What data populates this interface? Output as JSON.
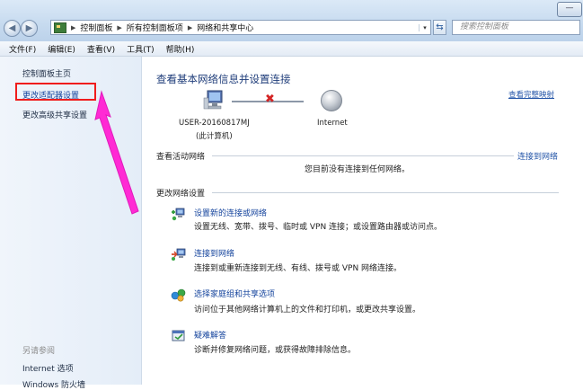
{
  "window": {
    "buttons": [
      "—"
    ]
  },
  "nav": {
    "back_glyph": "◀",
    "forward_glyph": "▶"
  },
  "address": {
    "crumbs": [
      "控制面板",
      "所有控制面板项",
      "网络和共享中心"
    ],
    "dropdown_glyph": "▾"
  },
  "refresh_glyph": "⇆",
  "search": {
    "placeholder": "搜索控制面板"
  },
  "menu": [
    "文件(F)",
    "编辑(E)",
    "查看(V)",
    "工具(T)",
    "帮助(H)"
  ],
  "sidebar": {
    "items": [
      "控制面板主页",
      "更改适配器设置",
      "更改高级共享设置"
    ],
    "see_also_title": "另请参阅",
    "see_also": [
      "Internet 选项",
      "Windows 防火墙"
    ]
  },
  "main": {
    "title": "查看基本网络信息并设置连接",
    "full_map_link": "查看完整映射",
    "computer_name": "USER-20160817MJ",
    "computer_sub": "(此计算机)",
    "internet_label": "Internet",
    "active_header": "查看活动网络",
    "connect_link": "连接到网络",
    "no_connection": "您目前没有连接到任何网络。",
    "change_header": "更改网络设置",
    "tasks": [
      {
        "title": "设置新的连接或网络",
        "desc": "设置无线、宽带、拨号、临时或 VPN 连接；或设置路由器或访问点。",
        "icon": "new-connection-icon"
      },
      {
        "title": "连接到网络",
        "desc": "连接到或重新连接到无线、有线、拨号或 VPN 网络连接。",
        "icon": "connect-network-icon"
      },
      {
        "title": "选择家庭组和共享选项",
        "desc": "访问位于其他网络计算机上的文件和打印机，或更改共享设置。",
        "icon": "homegroup-icon"
      },
      {
        "title": "疑难解答",
        "desc": "诊断并修复网络问题，或获得故障排除信息。",
        "icon": "troubleshoot-icon"
      }
    ]
  },
  "colors": {
    "highlight": "#f01c1c",
    "annotation_arrow": "#ff2ad4",
    "link": "#15449d"
  }
}
